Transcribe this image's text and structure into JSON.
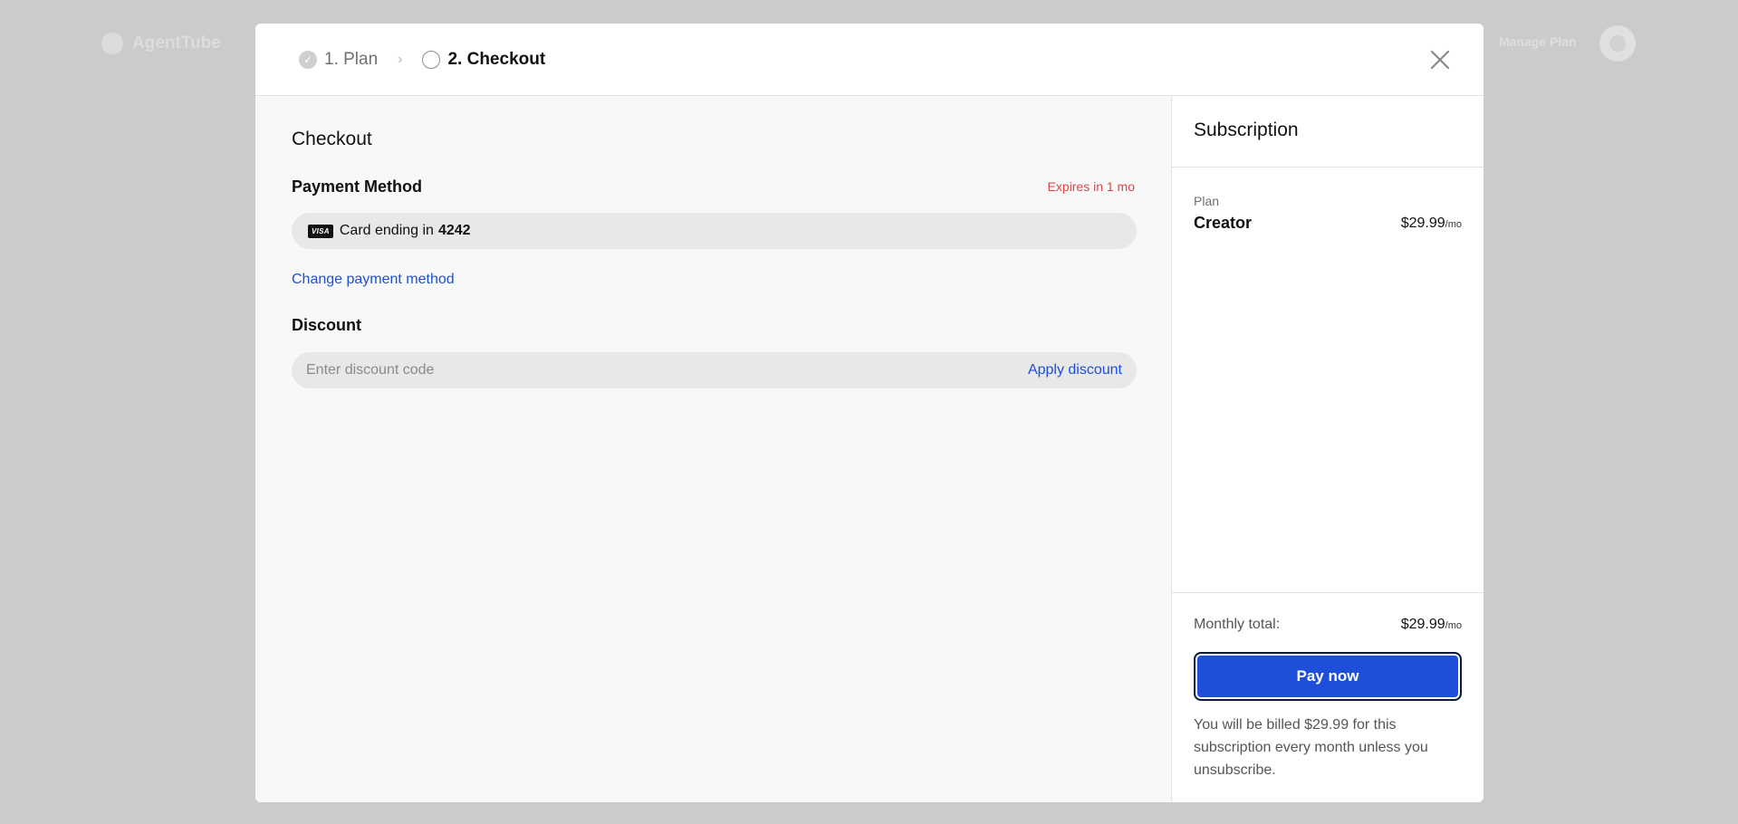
{
  "background": {
    "logo_text": "AgentTube",
    "manage_plan_label": "Manage Plan"
  },
  "stepper": {
    "step1_label": "1. Plan",
    "step2_label": "2. Checkout"
  },
  "checkout": {
    "title": "Checkout",
    "payment_method_title": "Payment Method",
    "card_expiry": "Expires in 1 mo",
    "card_brand": "VISA",
    "card_prefix": "Card ending in",
    "card_last4": "4242",
    "change_payment_label": "Change payment method",
    "discount_title": "Discount",
    "discount_placeholder": "Enter discount code",
    "discount_value": "",
    "apply_discount_label": "Apply discount"
  },
  "subscription": {
    "title": "Subscription",
    "plan_label": "Plan",
    "plan_name": "Creator",
    "plan_price": "$29.99",
    "per_period": "/mo",
    "monthly_total_label": "Monthly total:",
    "monthly_total_price": "$29.99",
    "pay_now_label": "Pay now",
    "billing_note": "You will be billed $29.99 for this subscription every month unless you unsubscribe."
  },
  "colors": {
    "accent": "#1d4fd8",
    "warning": "#d94848",
    "overlay": "#cbcbcb"
  }
}
